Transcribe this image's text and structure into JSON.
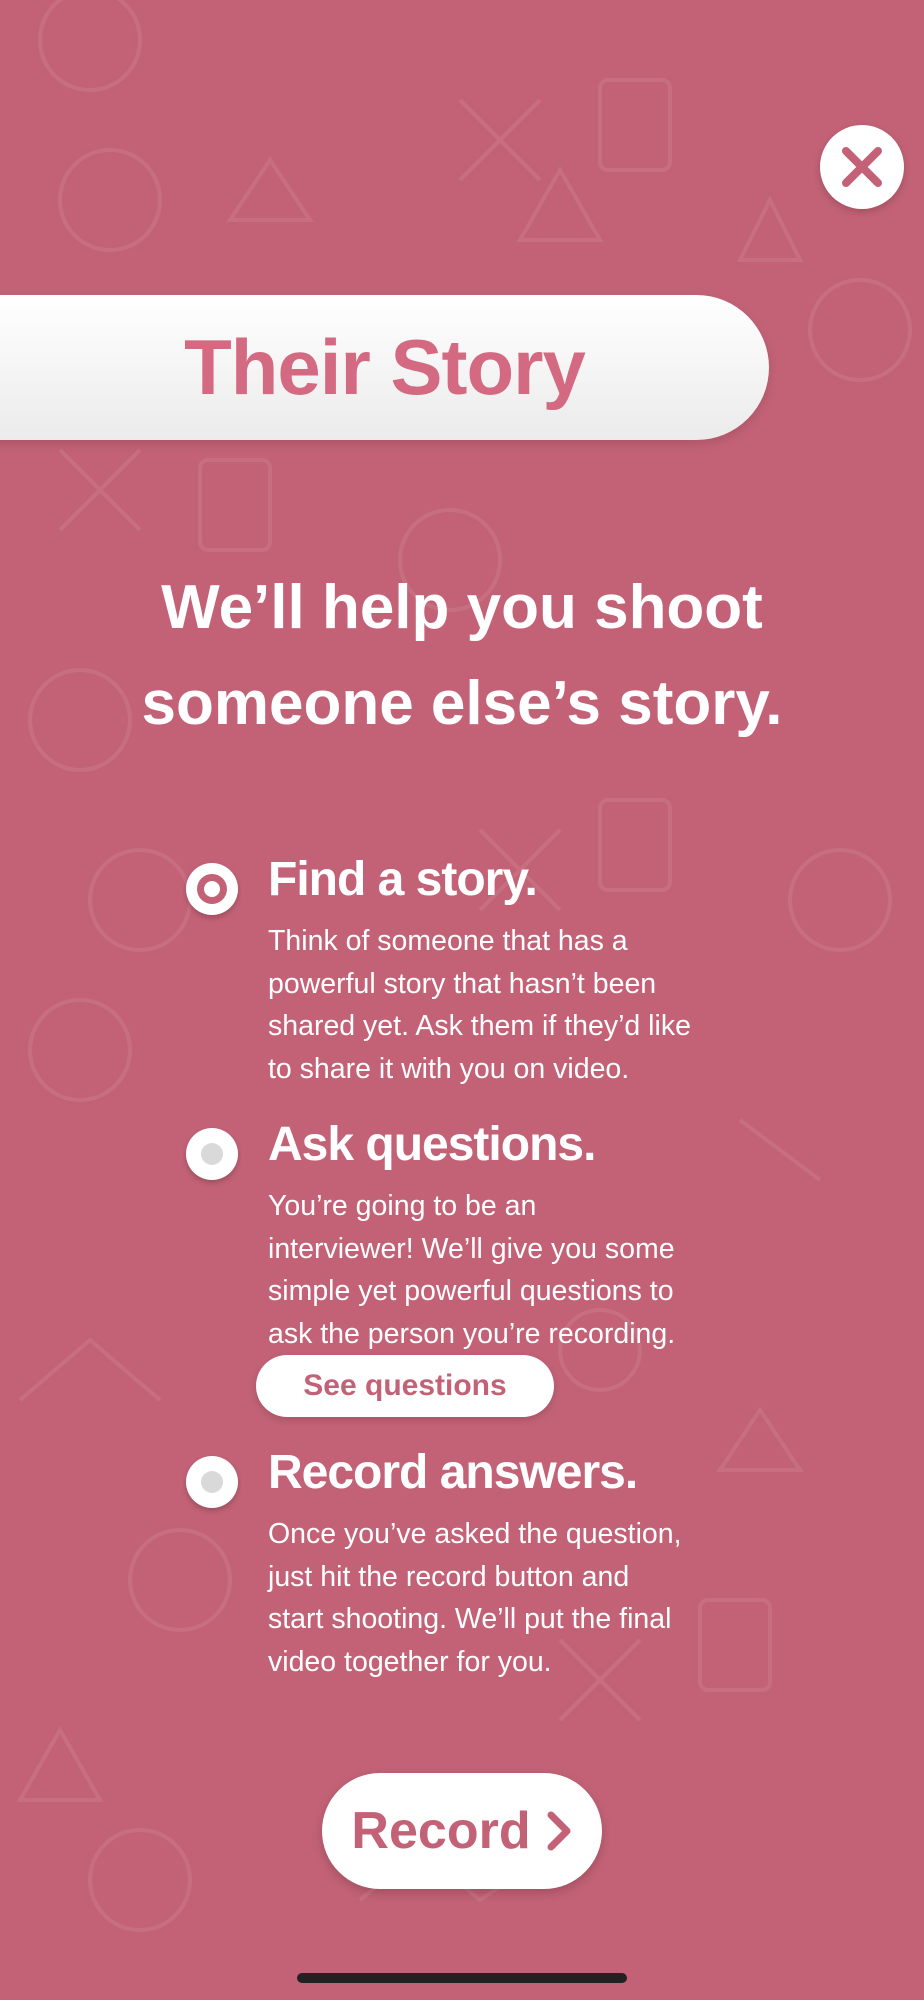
{
  "theme": {
    "background": "#c36276",
    "accent": "#d36a82",
    "text": "#ffffff"
  },
  "header": {
    "close_icon": "close-x-icon",
    "title": "Their Story"
  },
  "headline": {
    "line1": "We’ll help you shoot",
    "line2": "someone else’s story."
  },
  "steps": [
    {
      "title": "Find a story.",
      "lines": [
        "Think of someone that has a",
        "powerful story that hasn’t been",
        "shared yet. Ask them if they’d like",
        "to share it with you on video."
      ],
      "selected": true
    },
    {
      "title": "Ask questions.",
      "lines": [
        "You’re going to be an",
        "interviewer! We’ll give you some",
        "simple yet powerful questions to",
        "ask the person you’re recording."
      ],
      "selected": false,
      "link_label": "See questions"
    },
    {
      "title": "Record answers.",
      "lines": [
        "Once you’ve asked the question,",
        "just hit the record button and",
        "start shooting. We’ll put the final",
        "video together for you."
      ],
      "selected": false
    }
  ],
  "record_button": {
    "label": "Record",
    "icon": "chevron-right-icon"
  }
}
